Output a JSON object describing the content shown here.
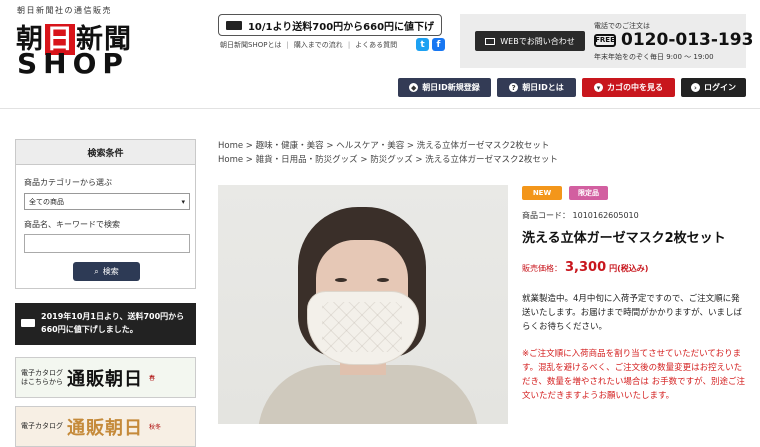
{
  "header": {
    "tagline": "朝日新聞社の通信販売",
    "logo_line1_a": "朝",
    "logo_line1_b": "日",
    "logo_line1_c": "新聞",
    "logo_line2": "SHOP",
    "notice": "10/1より送料700円から660円に値下げ",
    "sublinks": [
      "朝日新聞SHOPとは",
      "購入までの流れ",
      "よくある質問"
    ],
    "twitter": "t",
    "facebook": "f",
    "web_contact": "WEBでお問い合わせ",
    "phone_label": "電話でのご注文は",
    "phone_icon_text": "FREE",
    "phone": "0120-013-193",
    "hours": "年末年始をのぞく毎日 9:00 〜 19:00",
    "buttons": [
      {
        "label": "朝日ID新規登録",
        "icon": "shield-icon"
      },
      {
        "label": "朝日IDとは",
        "icon": "question-icon"
      },
      {
        "label": "カゴの中を見る",
        "icon": "cart-icon"
      },
      {
        "label": "ログイン",
        "icon": "login-icon"
      }
    ]
  },
  "sidebar": {
    "search_title": "検索条件",
    "category_label": "商品カテゴリーから選ぶ",
    "category_value": "全ての商品",
    "keyword_label": "商品名、キーワードで検索",
    "search_button": "検索",
    "banner": "2019年10月1日より、送料700円から660円に値下げしました。",
    "catalog1": {
      "small1": "電子カタログ",
      "small2": "はこちらから",
      "big": "通販朝日",
      "tag": "春"
    },
    "catalog2": {
      "small1": "電子カタログ",
      "small2": "",
      "big": "通販朝日",
      "tag": "秋冬"
    }
  },
  "breadcrumbs": [
    [
      "Home",
      "趣味・健康・美容",
      "ヘルスケア・美容",
      "洗える立体ガーゼマスク2枚セット"
    ],
    [
      "Home",
      "雑貨・日用品・防災グッズ",
      "防災グッズ",
      "洗える立体ガーゼマスク2枚セット"
    ]
  ],
  "product": {
    "badge_new": "NEW",
    "badge_limited": "限定品",
    "code": "商品コード： 1010162605010",
    "title": "洗える立体ガーゼマスク2枚セット",
    "price_label": "販売価格：",
    "price": "3,300",
    "price_suffix": "円(税込み)",
    "desc": "就業製造中。4月中旬に入荷予定ですので、ご注文順に発送いたします。お届けまで時間がかかりますが、いましばらくお待ちください。",
    "note": "※ご注文順に入荷商品を割り当てさせていただいております。混乱を避けるべく、ご注文後の数量変更はお控えいただき、数量を増やされたい場合は お手数ですが、別途ご注文いただきますようお願いいたします。"
  },
  "colors": {
    "accent_red": "#c8161d",
    "navy": "#333b55",
    "new_orange": "#f3961a",
    "limited_pink": "#d25fa0"
  }
}
